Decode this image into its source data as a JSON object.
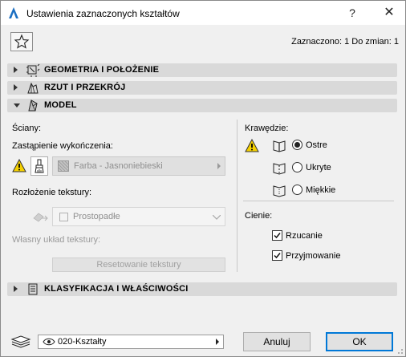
{
  "window": {
    "title": "Ustawienia zaznaczonych kształtów",
    "help_label": "?",
    "close_label": "✕"
  },
  "selection_info": "Zaznaczono: 1 Do zmian: 1",
  "sections": {
    "geometry": "GEOMETRIA I POŁOŻENIE",
    "plan": "RZUT I PRZEKRÓJ",
    "model": "MODEL",
    "classification": "KLASYFIKACJA I WŁAŚCIWOŚCI"
  },
  "model": {
    "faces_label": "Ściany:",
    "finish_override_label": "Zastąpienie wykończenia:",
    "surface_value": "Farba - Jasnoniebieski",
    "texture_mapping_label": "Rozłożenie tekstury:",
    "texture_mapping_value": "Prostopadłe",
    "custom_texture_label": "Własny układ tekstury:",
    "reset_texture_button": "Resetowanie tekstury",
    "edges_label": "Krawędzie:",
    "edge_options": [
      "Ostre",
      "Ukryte",
      "Miękkie"
    ],
    "edge_selected": "Ostre",
    "shadows_label": "Cienie:",
    "shadow_options": [
      {
        "label": "Rzucanie",
        "checked": true
      },
      {
        "label": "Przyjmowanie",
        "checked": true
      }
    ]
  },
  "footer": {
    "layer_value": "020-Kształty",
    "cancel_button": "Anuluj",
    "ok_button": "OK"
  },
  "colors": {
    "section_bg": "#d9d9d9",
    "warning_yellow": "#f5d000",
    "ok_border": "#0078d7"
  }
}
